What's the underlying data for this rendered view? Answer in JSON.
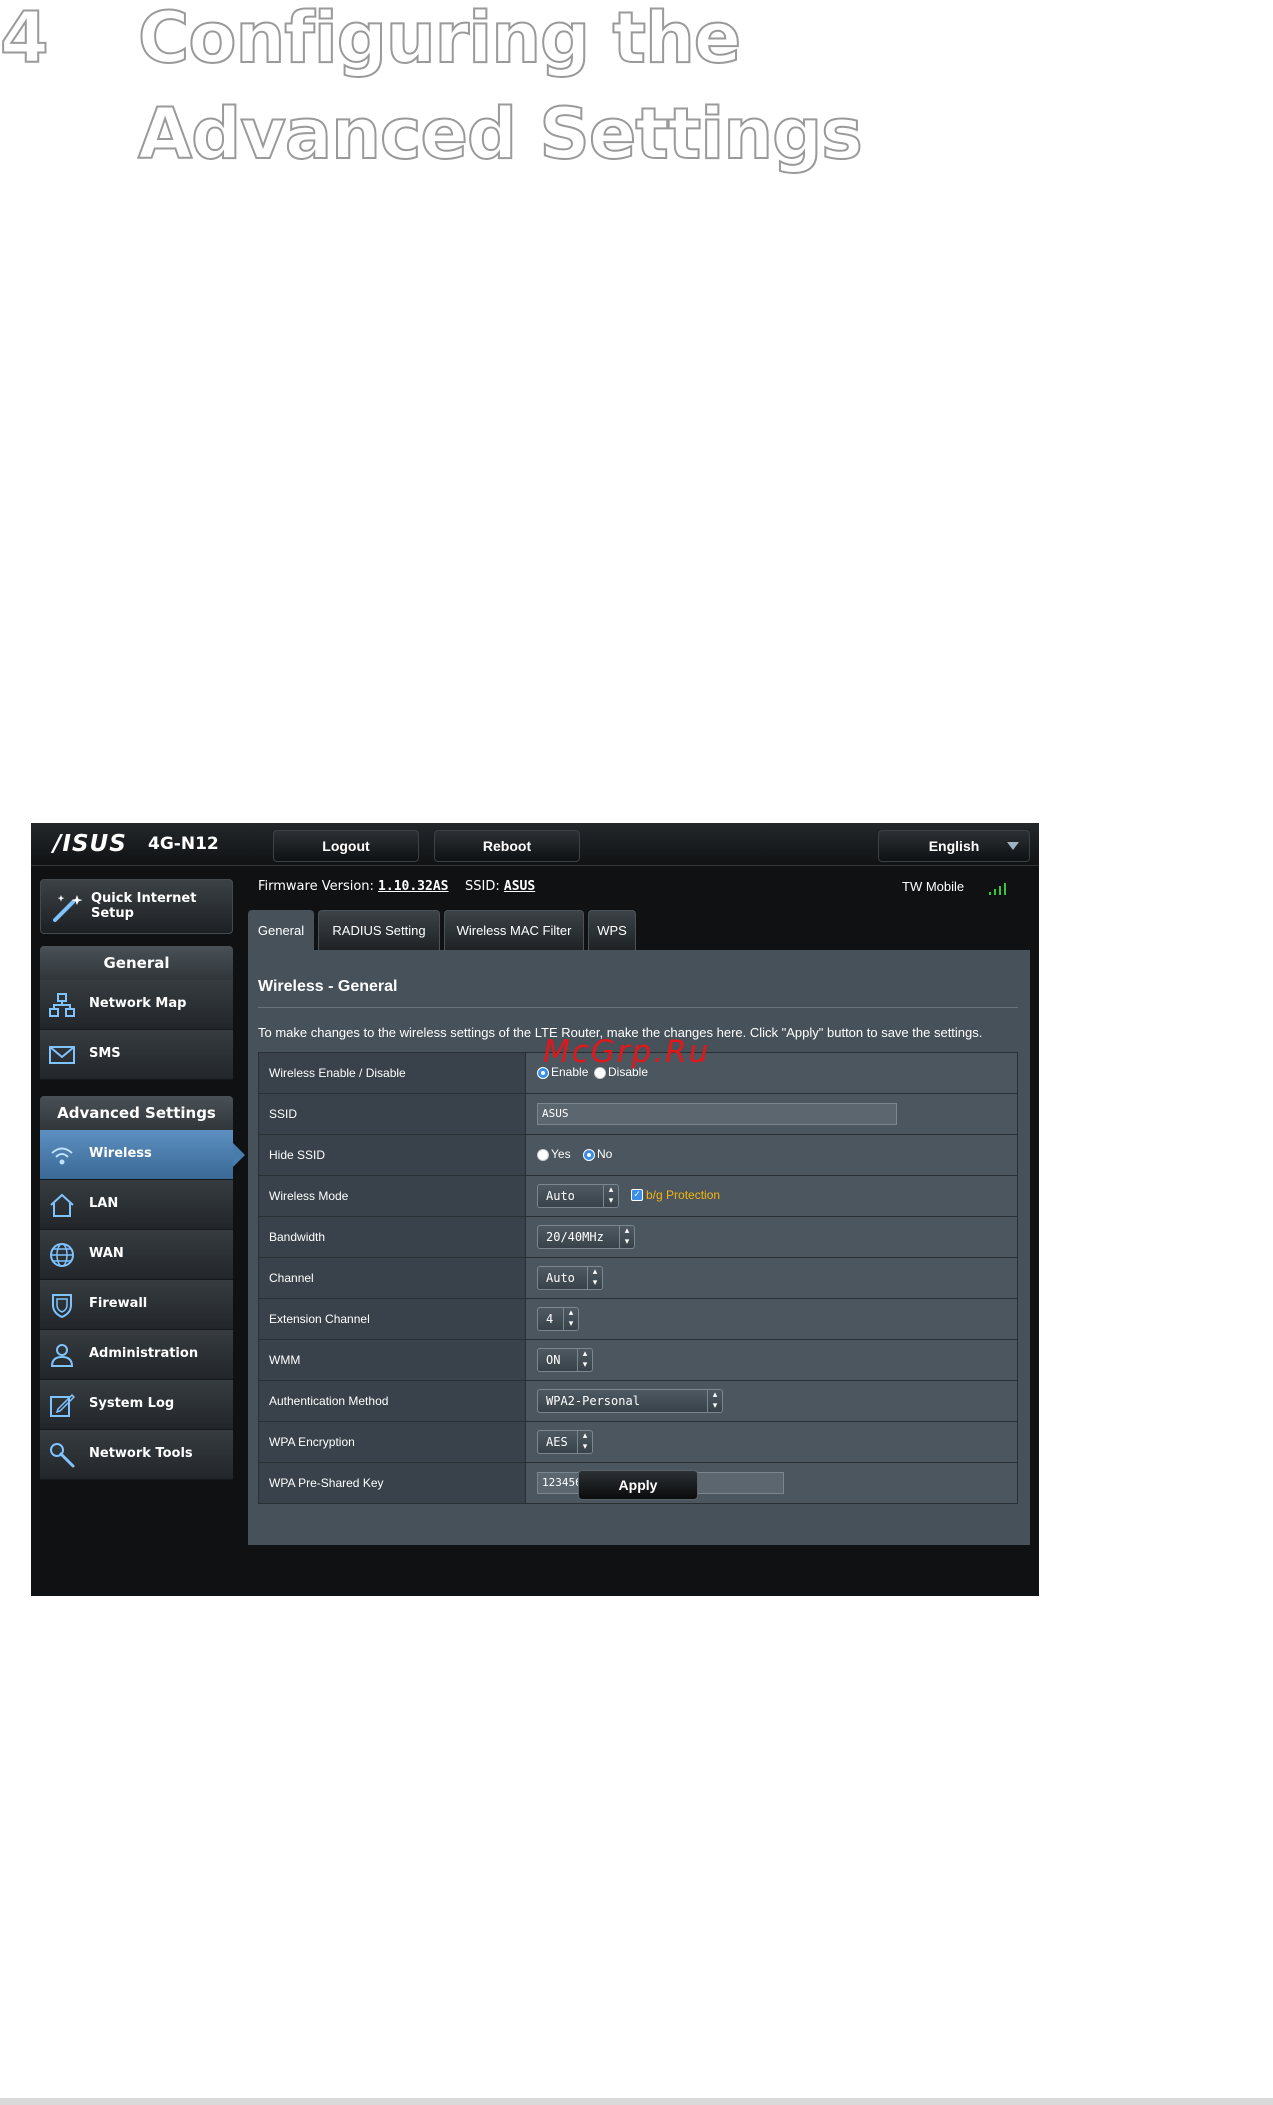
{
  "chapter": {
    "number": "4",
    "title": "Configuring the Advanced Settings"
  },
  "topbar": {
    "logo": "/ISUS",
    "model": "4G-N12",
    "logout": "Logout",
    "reboot": "Reboot",
    "language": "English"
  },
  "sidebar": {
    "quick_setup": "Quick Internet Setup",
    "general_header": "General",
    "general_items": [
      {
        "label": "Network Map",
        "icon": "network-map-icon"
      },
      {
        "label": "SMS",
        "icon": "envelope-icon"
      }
    ],
    "advanced_header": "Advanced Settings",
    "advanced_items": [
      {
        "label": "Wireless",
        "icon": "wifi-icon"
      },
      {
        "label": "LAN",
        "icon": "home-icon"
      },
      {
        "label": "WAN",
        "icon": "globe-icon"
      },
      {
        "label": "Firewall",
        "icon": "shield-icon"
      },
      {
        "label": "Administration",
        "icon": "user-icon"
      },
      {
        "label": "System Log",
        "icon": "edit-icon"
      },
      {
        "label": "Network Tools",
        "icon": "tools-icon"
      }
    ]
  },
  "status": {
    "firmware_label": "Firmware Version:",
    "firmware_value": "1.10.32AS",
    "ssid_label": "SSID:",
    "ssid_value": "ASUS",
    "carrier": "TW Mobile"
  },
  "tabs": [
    "General",
    "RADIUS Setting",
    "Wireless MAC Filter",
    "WPS"
  ],
  "panel": {
    "title": "Wireless - General",
    "description": "To make changes to the wireless settings of the LTE Router, make the changes here. Click \"Apply\" button to save the settings.",
    "rows": {
      "enable_label": "Wireless Enable / Disable",
      "enable_opt": "Enable",
      "disable_opt": "Disable",
      "ssid_label": "SSID",
      "ssid_value": "ASUS",
      "hide_label": "Hide SSID",
      "yes_opt": "Yes",
      "no_opt": "No",
      "mode_label": "Wireless Mode",
      "mode_value": "Auto",
      "bg_protection": "b/g Protection",
      "bandwidth_label": "Bandwidth",
      "bandwidth_value": "20/40MHz",
      "channel_label": "Channel",
      "channel_value": "Auto",
      "ext_label": "Extension Channel",
      "ext_value": "4",
      "wmm_label": "WMM",
      "wmm_value": "ON",
      "auth_label": "Authentication Method",
      "auth_value": "WPA2-Personal",
      "enc_label": "WPA Encryption",
      "enc_value": "AES",
      "psk_label": "WPA Pre-Shared Key",
      "psk_value": "12345678"
    },
    "apply": "Apply"
  },
  "watermark": "McGrp.Ru",
  "colors": {
    "accent": "#3a8ee6",
    "warning": "#f5b50a",
    "active_menu": "#4a7cab",
    "watermark": "#e0181c"
  }
}
